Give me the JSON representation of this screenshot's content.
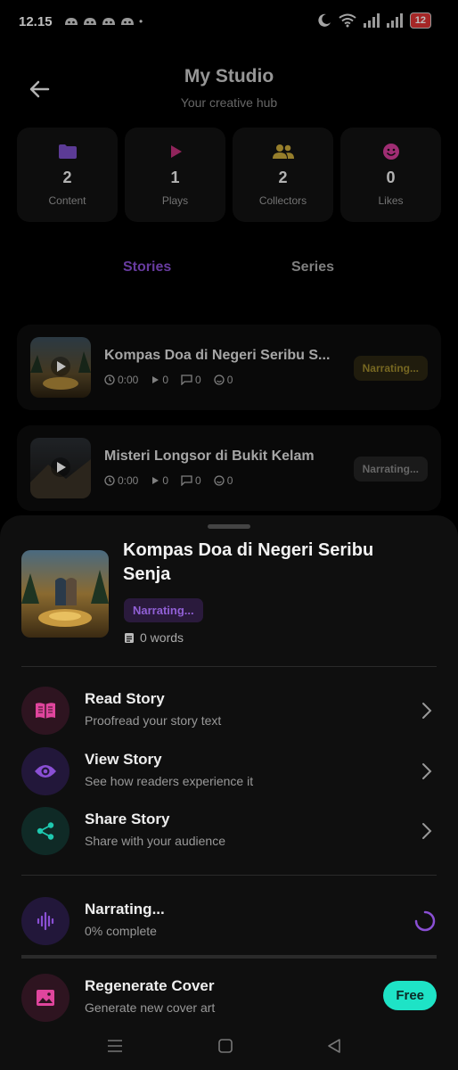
{
  "status_bar": {
    "time": "12.15",
    "notification_count": 4,
    "battery": "12"
  },
  "header": {
    "title": "My Studio",
    "subtitle": "Your creative hub"
  },
  "stats": [
    {
      "icon": "folder-icon",
      "color": "#7b4fc9",
      "value": "2",
      "label": "Content"
    },
    {
      "icon": "play-icon",
      "color": "#c0307a",
      "value": "1",
      "label": "Plays"
    },
    {
      "icon": "people-icon",
      "color": "#c9a83a",
      "value": "2",
      "label": "Collectors"
    },
    {
      "icon": "smile-icon",
      "color": "#d43c9a",
      "value": "0",
      "label": "Likes"
    }
  ],
  "tabs": {
    "stories": "Stories",
    "series": "Series"
  },
  "stories": [
    {
      "title": "Kompas Doa di Negeri Seribu S...",
      "duration": "0:00",
      "plays": "0",
      "comments": "0",
      "likes": "0",
      "status": "Narrating..."
    },
    {
      "title": "Misteri Longsor di Bukit Kelam",
      "duration": "0:00",
      "plays": "0",
      "comments": "0",
      "likes": "0",
      "status": "Narrating..."
    }
  ],
  "sheet": {
    "title": "Kompas Doa di Negeri Seribu Senja",
    "status": "Narrating...",
    "words": "0 words",
    "actions": [
      {
        "icon": "book-icon",
        "title": "Read Story",
        "subtitle": "Proofread your story text"
      },
      {
        "icon": "eye-icon",
        "title": "View Story",
        "subtitle": "See how readers experience it"
      },
      {
        "icon": "share-icon",
        "title": "Share Story",
        "subtitle": "Share with your audience"
      }
    ],
    "narrating": {
      "title": "Narrating...",
      "subtitle": "0% complete",
      "progress": 0
    },
    "regenerate": {
      "title": "Regenerate Cover",
      "subtitle": "Generate new cover art",
      "badge": "Free"
    }
  },
  "colors": {
    "accent": "#8a4fd4",
    "free_badge": "#1ee3c6",
    "pink": "#e0459d",
    "teal": "#1ec9b0"
  }
}
